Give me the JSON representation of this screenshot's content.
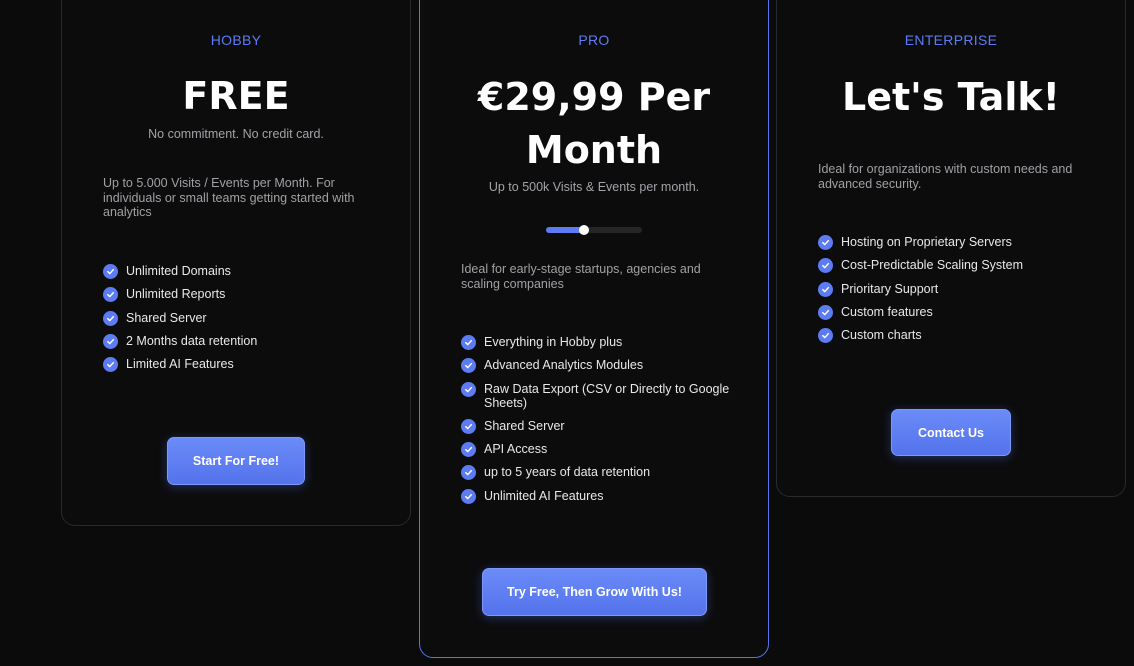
{
  "plans": {
    "hobby": {
      "tier": "HOBBY",
      "price": "FREE",
      "subtitle": "No commitment. No credit card.",
      "description": "Up to 5.000 Visits / Events per Month. For individuals or small teams getting started with analytics",
      "features": [
        "Unlimited Domains",
        "Unlimited Reports",
        "Shared Server",
        "2 Months data retention",
        "Limited AI Features"
      ],
      "button": "Start For Free!"
    },
    "pro": {
      "tier": "PRO",
      "price_line1": "€29,99 Per",
      "price_line2": "Month",
      "subtitle": "Up to 500k Visits & Events per month.",
      "slider_level": 0.4,
      "description": "Ideal for early-stage startups, agencies and scaling companies",
      "features": [
        "Everything in Hobby plus",
        "Advanced Analytics Modules",
        "Raw Data Export (CSV or Directly to Google Sheets)",
        "Shared Server",
        "API Access",
        "up to 5 years of data retention",
        "Unlimited AI Features"
      ],
      "button": "Try Free, Then Grow With Us!"
    },
    "enterprise": {
      "tier": "ENTERPRISE",
      "price": "Let's Talk!",
      "description": "Ideal for organizations with custom needs and advanced security.",
      "features": [
        "Hosting on Proprietary Servers",
        "Cost-Predictable Scaling System",
        "Prioritary Support",
        "Custom features",
        "Custom charts"
      ],
      "button": "Contact Us"
    }
  },
  "colors": {
    "background": "#0b0b0c",
    "accent": "#5b7cf5",
    "highlight_border": "#5574ee",
    "check": "#5d7cf3"
  },
  "icons": {
    "feature": "check-circle-icon"
  }
}
